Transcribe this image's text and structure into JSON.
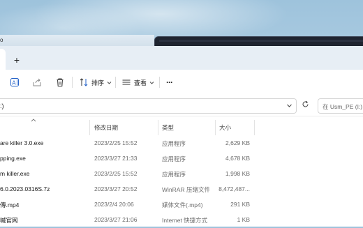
{
  "background": {
    "ghost_text": "o"
  },
  "tabs": {
    "new_tab": "+"
  },
  "toolbar": {
    "sort_label": "排序",
    "view_label": "查看",
    "more_label": "···"
  },
  "address": {
    "path": ":)",
    "search_placeholder": "在 Usm_PE (I:) 中"
  },
  "columns": {
    "date": "修改日期",
    "type": "类型",
    "size": "大小"
  },
  "files": [
    {
      "name": "are killer 3.0.exe",
      "date": "2023/2/25 15:52",
      "type": "应用程序",
      "size": "2,629 KB"
    },
    {
      "name": "pping.exe",
      "date": "2023/3/27 21:33",
      "type": "应用程序",
      "size": "4,678 KB"
    },
    {
      "name": "m killer.exe",
      "date": "2023/2/25 15:52",
      "type": "应用程序",
      "size": "1,998 KB"
    },
    {
      "name": "6.0.2023.0316S.7z",
      "date": "2023/3/27 20:52",
      "type": "WinRAR 压缩文件",
      "size": "8,472,487..."
    },
    {
      "name": "傳.mp4",
      "date": "2023/2/4 20:06",
      "type": "媒体文件(.mp4)",
      "size": "291 KB"
    },
    {
      "name": "嘁官网",
      "date": "2023/3/27 21:06",
      "type": "Internet 快捷方式",
      "size": "1 KB"
    }
  ],
  "colors": {
    "accent": "#2563c9",
    "dark_window": "#1f2430"
  }
}
